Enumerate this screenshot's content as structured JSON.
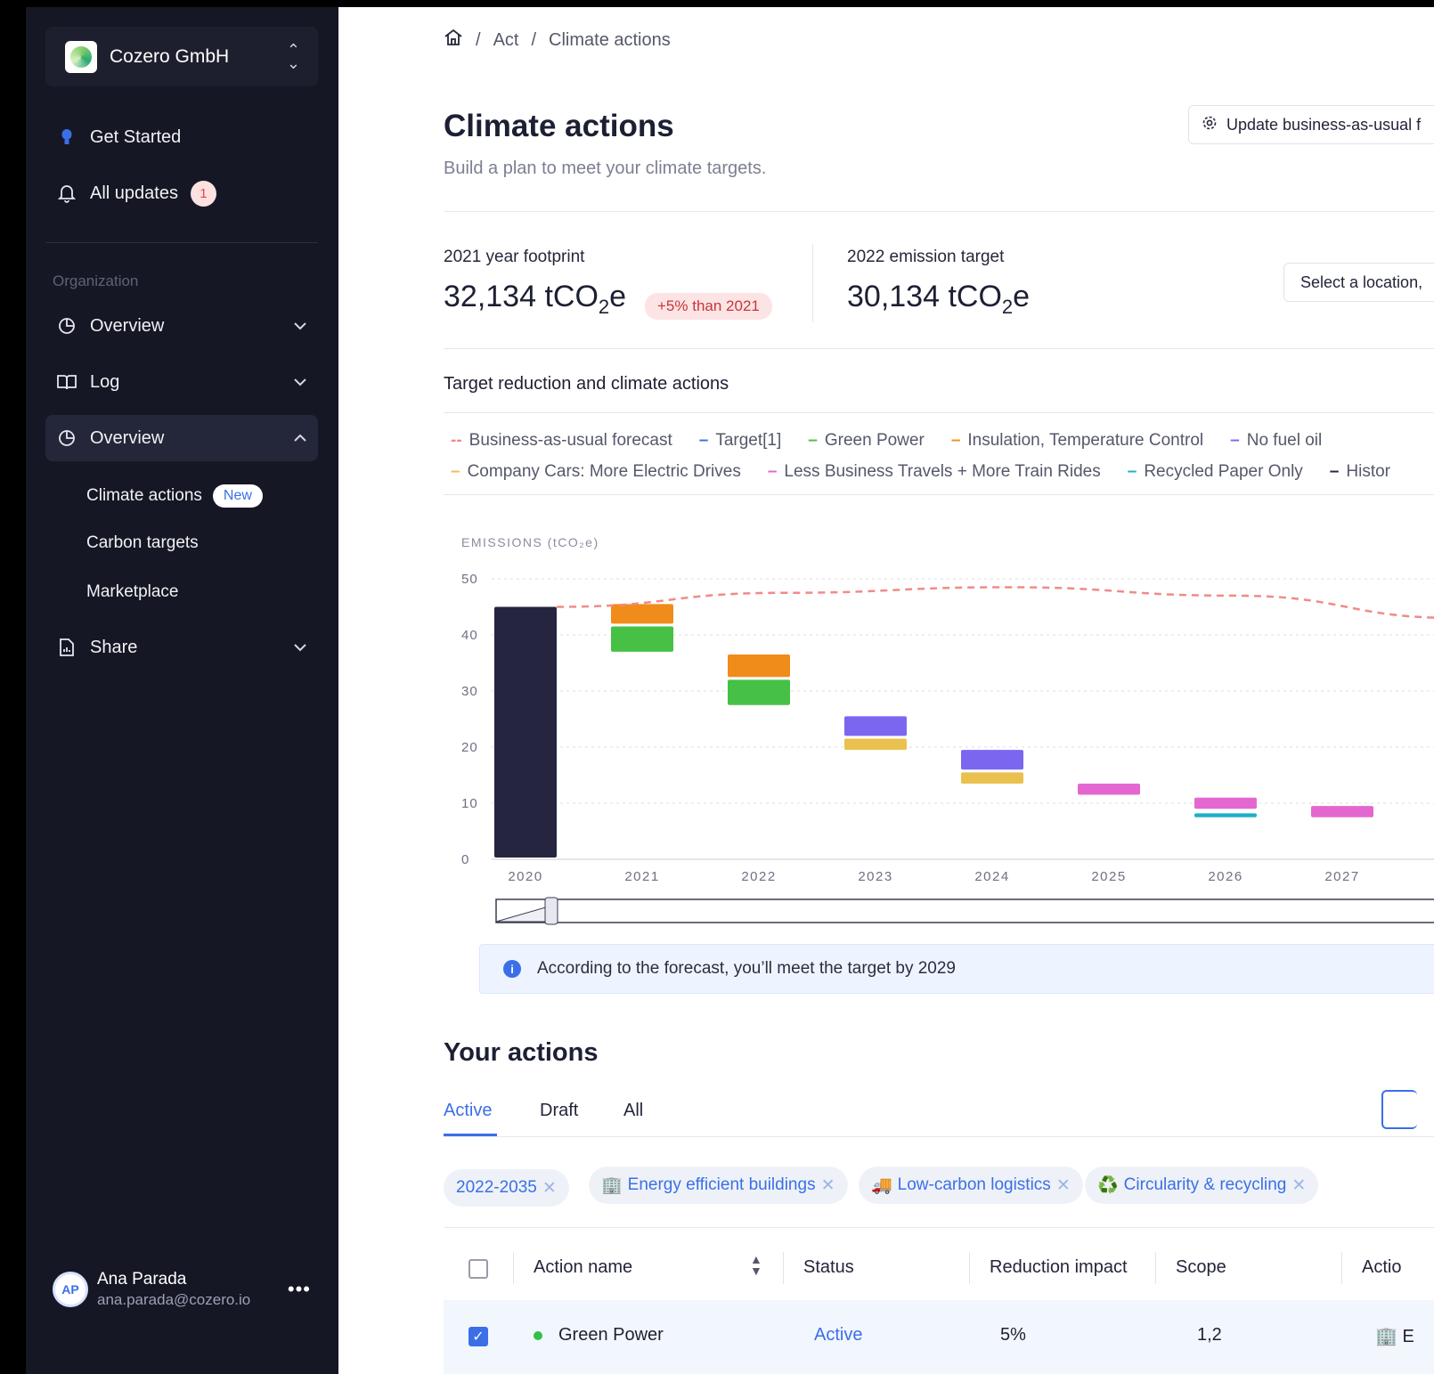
{
  "sidebar": {
    "org_name": "Cozero GmbH",
    "get_started": "Get Started",
    "all_updates": "All updates",
    "updates_count": "1",
    "section_label": "Organization",
    "nav": [
      {
        "label": "Overview"
      },
      {
        "label": "Log"
      },
      {
        "label": "Overview"
      },
      {
        "label": "Share"
      }
    ],
    "sub": {
      "climate_actions": "Climate actions",
      "new_badge": "New",
      "carbon_targets": "Carbon targets",
      "marketplace": "Marketplace"
    },
    "user": {
      "initials": "AP",
      "name": "Ana Parada",
      "email": "ana.parada@cozero.io"
    }
  },
  "breadcrumb": {
    "act": "Act",
    "current": "Climate actions",
    "sep": "/"
  },
  "page": {
    "title": "Climate actions",
    "subtitle": "Build a plan to meet your climate targets.",
    "bau_button": "Update business-as-usual f"
  },
  "stats": {
    "footprint_label": "2021 year footprint",
    "footprint_value": "32,134 tCO",
    "footprint_trend": "+5% than 2021",
    "target_label": "2022 emission target",
    "target_value": "30,134 tCO",
    "co2_sub": "2",
    "co2_suffix": "e",
    "location_placeholder": "Select a location,"
  },
  "chart_section": {
    "title": "Target reduction and climate actions",
    "legend_row1": [
      {
        "label": "Business-as-usual forecast",
        "marker": "--",
        "color": "#f08b86"
      },
      {
        "label": "Target[1]",
        "marker": "–",
        "color": "#3b6fe8"
      },
      {
        "label": "Green Power",
        "marker": "–",
        "color": "#46c146"
      },
      {
        "label": "Insulation, Temperature Control",
        "marker": "–",
        "color": "#f08c1a"
      },
      {
        "label": "No fuel oil",
        "marker": "–",
        "color": "#7b66f0"
      }
    ],
    "legend_row2": [
      {
        "label": "Company Cars: More Electric Drives",
        "marker": "–",
        "color": "#eac14f"
      },
      {
        "label": "Less Business Travels + More Train Rides",
        "marker": "–",
        "color": "#e467d0"
      },
      {
        "label": "Recycled Paper Only",
        "marker": "–",
        "color": "#1cb0c7"
      },
      {
        "label": "Histor",
        "marker": "–",
        "color": "#23253a"
      }
    ]
  },
  "chart_data": {
    "type": "bar",
    "ylabel": "EMISSIONS (tCO₂e)",
    "ylim": [
      0,
      50
    ],
    "yticks": [
      0,
      10,
      20,
      30,
      40,
      50
    ],
    "categories": [
      "2020",
      "2021",
      "2022",
      "2023",
      "2024",
      "2025",
      "2026",
      "2027"
    ],
    "grid": true,
    "historic": [
      {
        "x": "2020",
        "value": 45
      }
    ],
    "segments": [
      {
        "x": "2021",
        "series": "Green Power",
        "y0": 37,
        "y1": 41.5,
        "color": "#46c146"
      },
      {
        "x": "2021",
        "series": "Insulation, Temperature Control",
        "y0": 42,
        "y1": 45.5,
        "color": "#f08c1a"
      },
      {
        "x": "2022",
        "series": "Green Power",
        "y0": 27.5,
        "y1": 32,
        "color": "#46c146"
      },
      {
        "x": "2022",
        "series": "Insulation, Temperature Control",
        "y0": 32.5,
        "y1": 36.5,
        "color": "#f08c1a"
      },
      {
        "x": "2023",
        "series": "Company Cars: More Electric Drives",
        "y0": 19.5,
        "y1": 21.5,
        "color": "#eac14f"
      },
      {
        "x": "2023",
        "series": "No fuel oil",
        "y0": 22,
        "y1": 25.5,
        "color": "#7b66f0"
      },
      {
        "x": "2024",
        "series": "Company Cars: More Electric Drives",
        "y0": 13.5,
        "y1": 15.5,
        "color": "#eac14f"
      },
      {
        "x": "2024",
        "series": "No fuel oil",
        "y0": 16,
        "y1": 19.5,
        "color": "#7b66f0"
      },
      {
        "x": "2025",
        "series": "Less Business Travels + More Train Rides",
        "y0": 11.5,
        "y1": 13.5,
        "color": "#e467d0"
      },
      {
        "x": "2026",
        "series": "Recycled Paper Only",
        "y0": 7.5,
        "y1": 8.2,
        "color": "#1cb0c7"
      },
      {
        "x": "2026",
        "series": "Less Business Travels + More Train Rides",
        "y0": 9,
        "y1": 11,
        "color": "#e467d0"
      },
      {
        "x": "2027",
        "series": "Less Business Travels + More Train Rides",
        "y0": 7.5,
        "y1": 9.5,
        "color": "#e467d0"
      }
    ],
    "bau_forecast": {
      "x_range": [
        "2020",
        "2028"
      ],
      "values": [
        45,
        47.5,
        48.5,
        47,
        43
      ]
    }
  },
  "info": {
    "text": "According to the forecast, you’ll meet the target by 2029"
  },
  "actions": {
    "title": "Your actions",
    "tabs": [
      "Active",
      "Draft",
      "All"
    ],
    "filters": [
      {
        "icon": "",
        "label": "2022-2035"
      },
      {
        "icon": "🏢",
        "label": "Energy efficient buildings"
      },
      {
        "icon": "🚚",
        "label": "Low-carbon logistics"
      },
      {
        "icon": "♻️",
        "label": "Circularity & recycling"
      }
    ],
    "columns": [
      "Action name",
      "Status",
      "Reduction impact",
      "Scope",
      "Actio"
    ],
    "rows": [
      {
        "name": "Green Power",
        "status": "Active",
        "impact": "5%",
        "scope": "1,2",
        "category": "🏢 E"
      }
    ]
  }
}
